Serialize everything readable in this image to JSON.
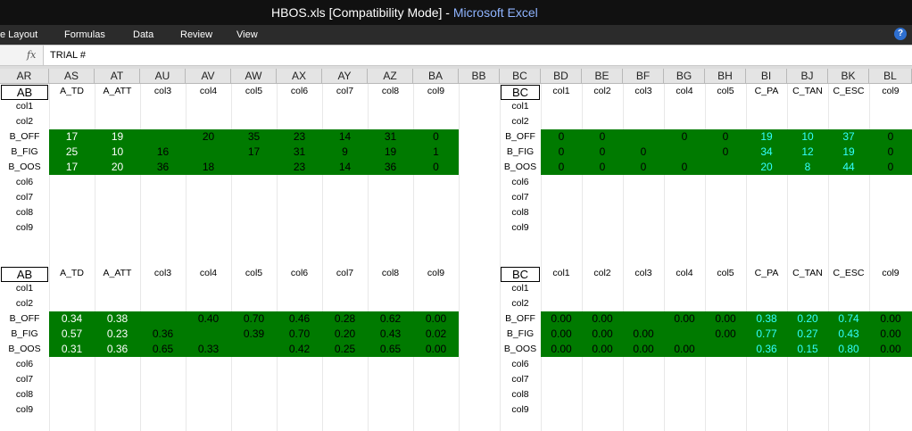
{
  "window": {
    "filename": "HBOS.xls",
    "mode": "[Compatibility Mode]",
    "separator": "-",
    "app": "Microsoft Excel"
  },
  "ribbon": {
    "tabs": [
      "e Layout",
      "Formulas",
      "Data",
      "Review",
      "View"
    ],
    "help": "?"
  },
  "formula_bar": {
    "fx": "fx",
    "content": "TRIAL #"
  },
  "column_headers": [
    "AR",
    "AS",
    "AT",
    "AU",
    "AV",
    "AW",
    "AX",
    "AY",
    "AZ",
    "BA",
    "BB",
    "BC",
    "BD",
    "BE",
    "BF",
    "BG",
    "BH",
    "BI",
    "BJ",
    "BK",
    "BL"
  ],
  "colors": {
    "fill": "#007a00",
    "text_white": "#ffffff",
    "text_black": "#000000",
    "text_cyan": "#33ffff"
  },
  "blocks": [
    {
      "left": {
        "corner": "AB",
        "headers": [
          "A_TD",
          "A_ATT",
          "col3",
          "col4",
          "col5",
          "col6",
          "col7",
          "col8",
          "col9"
        ],
        "rows": [
          "col1",
          "col2",
          "B_OFF",
          "B_FIG",
          "B_OOS",
          "col6",
          "col7",
          "col8",
          "col9"
        ],
        "values": [
          [
            "17",
            "19",
            "",
            "20",
            "35",
            "23",
            "14",
            "31",
            "0"
          ],
          [
            "25",
            "10",
            "16",
            "",
            "17",
            "31",
            "9",
            "19",
            "1"
          ],
          [
            "17",
            "20",
            "36",
            "18",
            "",
            "23",
            "14",
            "36",
            "0"
          ]
        ]
      },
      "right": {
        "corner": "BC",
        "headers": [
          "col1",
          "col2",
          "col3",
          "col4",
          "col5",
          "C_PA",
          "C_TAN",
          "C_ESC",
          "col9"
        ],
        "rows": [
          "col1",
          "col2",
          "B_OFF",
          "B_FIG",
          "B_OOS",
          "col6",
          "col7",
          "col8",
          "col9"
        ],
        "values": [
          [
            "0",
            "0",
            "",
            "0",
            "0",
            "19",
            "10",
            "37",
            "0"
          ],
          [
            "0",
            "0",
            "0",
            "",
            "0",
            "34",
            "12",
            "19",
            "0"
          ],
          [
            "0",
            "0",
            "0",
            "0",
            "",
            "20",
            "8",
            "44",
            "0"
          ]
        ]
      }
    },
    {
      "left": {
        "corner": "AB",
        "headers": [
          "A_TD",
          "A_ATT",
          "col3",
          "col4",
          "col5",
          "col6",
          "col7",
          "col8",
          "col9"
        ],
        "rows": [
          "col1",
          "col2",
          "B_OFF",
          "B_FIG",
          "B_OOS",
          "col6",
          "col7",
          "col8",
          "col9"
        ],
        "values": [
          [
            "0.34",
            "0.38",
            "",
            "0.40",
            "0.70",
            "0.46",
            "0.28",
            "0.62",
            "0.00"
          ],
          [
            "0.57",
            "0.23",
            "0.36",
            "",
            "0.39",
            "0.70",
            "0.20",
            "0.43",
            "0.02"
          ],
          [
            "0.31",
            "0.36",
            "0.65",
            "0.33",
            "",
            "0.42",
            "0.25",
            "0.65",
            "0.00"
          ]
        ]
      },
      "right": {
        "corner": "BC",
        "headers": [
          "col1",
          "col2",
          "col3",
          "col4",
          "col5",
          "C_PA",
          "C_TAN",
          "C_ESC",
          "col9"
        ],
        "rows": [
          "col1",
          "col2",
          "B_OFF",
          "B_FIG",
          "B_OOS",
          "col6",
          "col7",
          "col8",
          "col9"
        ],
        "values": [
          [
            "0.00",
            "0.00",
            "",
            "0.00",
            "0.00",
            "0.38",
            "0.20",
            "0.74",
            "0.00"
          ],
          [
            "0.00",
            "0.00",
            "0.00",
            "",
            "0.00",
            "0.77",
            "0.27",
            "0.43",
            "0.00"
          ],
          [
            "0.00",
            "0.00",
            "0.00",
            "0.00",
            "",
            "0.36",
            "0.15",
            "0.80",
            "0.00"
          ]
        ]
      }
    }
  ]
}
